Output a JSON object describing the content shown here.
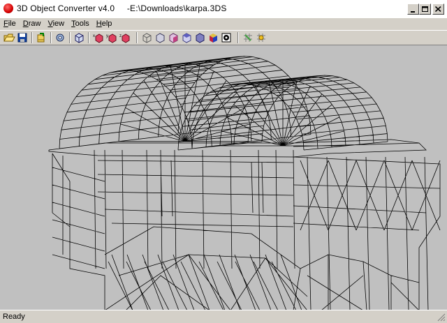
{
  "window": {
    "title": "3D Object Converter v4.0     -E:\\Downloads\\karpa.3DS",
    "minimize_glyph": "_",
    "maximize_glyph": "□",
    "close_glyph": "✕"
  },
  "menu": [
    {
      "acc": "F",
      "rest": "ile"
    },
    {
      "acc": "D",
      "rest": "raw"
    },
    {
      "acc": "V",
      "rest": "iew"
    },
    {
      "acc": "T",
      "rest": "ools"
    },
    {
      "acc": "H",
      "rest": "elp"
    }
  ],
  "toolbar": {
    "icons": [
      "open-folder-icon",
      "save-disk-icon",
      "import-icon",
      "settings-gear-icon",
      "select-cube-icon",
      "rotate-x-icon",
      "rotate-y-icon",
      "rotate-z-icon",
      "wireframe-view-icon",
      "front-view-icon",
      "side-view-icon",
      "top-view-icon",
      "solid-view-icon",
      "shaded-view-icon",
      "texture-view-icon",
      "grid-icon",
      "light-icon"
    ]
  },
  "status": {
    "text": "Ready"
  }
}
